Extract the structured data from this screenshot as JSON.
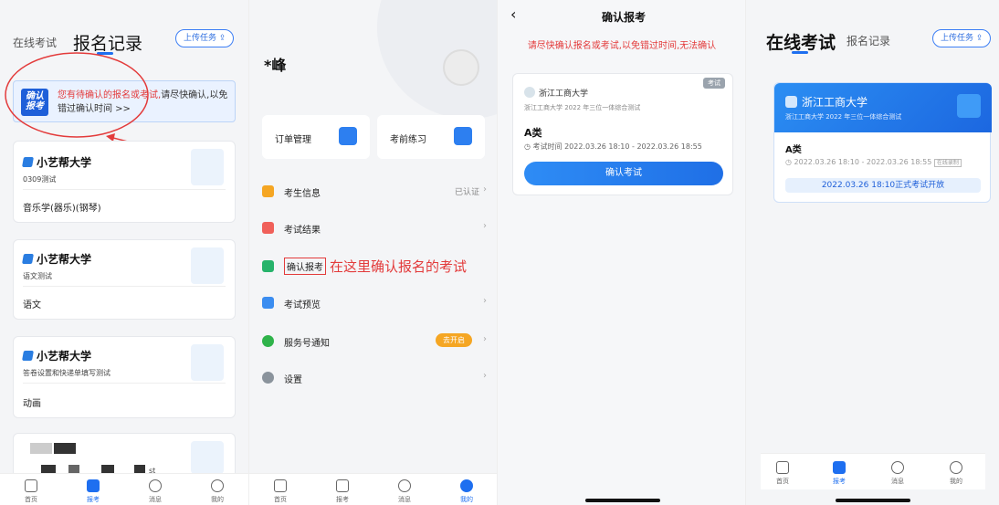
{
  "panel1": {
    "tab_online": "在线考试",
    "tab_records": "报名记录",
    "upload_btn": "上传任务",
    "notice_badge": "确认报考",
    "notice_text_red": "您有待确认的报名或考试,",
    "notice_text_rest": "请尽快确认,以免错过确认时间 >>",
    "cards": [
      {
        "uni": "小艺帮大学",
        "sub": "0309测试",
        "subject": "音乐学(器乐)(钢琴)"
      },
      {
        "uni": "小艺帮大学",
        "sub": "语文测试",
        "subject": "语文"
      },
      {
        "uni": "小艺帮大学",
        "sub": "答卷设置和快递单填写测试",
        "subject": "动画"
      }
    ],
    "card4_suffix": "st",
    "nav": [
      "首页",
      "报考",
      "消息",
      "我的"
    ]
  },
  "panel2": {
    "name": "*峰",
    "quick1": "订单管理",
    "quick2": "考前练习",
    "menu": [
      {
        "label": "考生信息",
        "right": "已认证"
      },
      {
        "label": "考试结果",
        "right": ""
      },
      {
        "label": "确认报考",
        "right": ""
      },
      {
        "label": "考试预览",
        "right": ""
      },
      {
        "label": "服务号通知",
        "right": "去开启"
      },
      {
        "label": "设置",
        "right": ""
      }
    ],
    "annotation": "在这里确认报名的考试",
    "nav": [
      "首页",
      "报考",
      "消息",
      "我的"
    ]
  },
  "panel3": {
    "title": "确认报考",
    "warning": "请尽快确认报名或考试,以免错过时间,无法确认",
    "tag": "考试",
    "uni": "浙江工商大学",
    "sub": "浙江工商大学 2022 年三位一体综合测试",
    "category": "A类",
    "time_label": "考试时间",
    "time": "2022.03.26 18:10 - 2022.03.26 18:55",
    "button": "确认考试"
  },
  "panel4": {
    "tab_online": "在线考试",
    "tab_records": "报名记录",
    "upload_btn": "上传任务",
    "uni": "浙江工商大学",
    "sub": "浙江工商大学 2022 年三位一体综合测试",
    "category": "A类",
    "time": "2022.03.26 18:10 - 2022.03.26 18:55",
    "small_tag": "在线录制",
    "open_bar": "2022.03.26 18:10正式考试开放",
    "nav": [
      "首页",
      "报考",
      "消息",
      "我的"
    ]
  },
  "colors": {
    "accent": "#1e6ff0",
    "annotation_red": "#e33b3b",
    "warning_orange": "#f5a623"
  }
}
